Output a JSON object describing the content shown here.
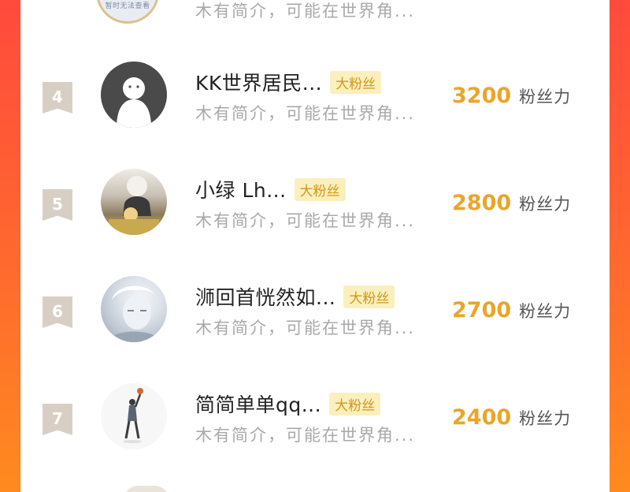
{
  "colors": {
    "background_gradient": [
      "#ff4a3d",
      "#ff8a1f"
    ],
    "card": "#ffffff",
    "rank_badge": "#d8cfc4",
    "tag_bg": "#fbf0bd",
    "tag_text": "#d39619",
    "score": "#eaa52a"
  },
  "top_partial_row": {
    "avatar_caption": "暂时无法查看",
    "bio": "木有简介，可能在世界角..."
  },
  "rows": [
    {
      "rank": "4",
      "name": "KK世界居民...",
      "tag": "大粉丝",
      "bio": "木有简介，可能在世界角...",
      "score": "3200",
      "unit": "粉丝力",
      "avatar_icon": "ghost-avatar-icon"
    },
    {
      "rank": "5",
      "name": "小绿  Lh...",
      "tag": "大粉丝",
      "bio": "木有简介，可能在世界角...",
      "score": "2800",
      "unit": "粉丝力",
      "avatar_icon": "anime-avatar-icon"
    },
    {
      "rank": "6",
      "name": "浉回首恍然如...",
      "tag": "大粉丝",
      "bio": "木有简介，可能在世界角...",
      "score": "2700",
      "unit": "粉丝力",
      "avatar_icon": "anime-avatar-icon"
    },
    {
      "rank": "7",
      "name": "简简单单qq...",
      "tag": "大粉丝",
      "bio": "木有简介，可能在世界角...",
      "score": "2400",
      "unit": "粉丝力",
      "avatar_icon": "basketball-player-avatar-icon"
    }
  ]
}
